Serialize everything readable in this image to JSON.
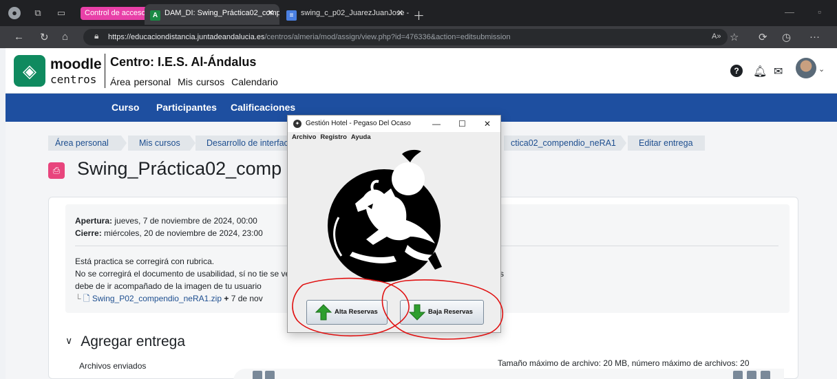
{
  "browser": {
    "tab_group": "Control de accesos",
    "tabs": [
      {
        "title": "DAM_DI: Swing_Práctica02_comp",
        "favicon": "A",
        "active": true
      },
      {
        "title": "swing_c_p02_JuarezJuanJose - Do",
        "favicon": "≡",
        "active": false
      }
    ],
    "url_host": "https://educaciondistancia.juntadeandalucia.es",
    "url_path": "/centros/almeria/mod/assign/view.php?id=476336&action=editsubmission",
    "icons": [
      "back-icon",
      "refresh-icon",
      "home-icon",
      "site-info-icon",
      "read-aloud-icon",
      "favorite-icon",
      "extensions-icon",
      "history-icon",
      "more-icon"
    ]
  },
  "site": {
    "logo_word": "moodle",
    "logo_sub": "centros",
    "centro": "Centro: I.E.S. Al-Ándalus",
    "nav": [
      "Área personal",
      "Mis cursos",
      "Calendario"
    ],
    "help": "?"
  },
  "course_nav": [
    "Curso",
    "Participantes",
    "Calificaciones"
  ],
  "breadcrumb": [
    "Área personal",
    "Mis cursos",
    "Desarrollo de interfac",
    "ctica02_compendio_neRA1",
    "Editar entrega"
  ],
  "page_title": "Swing_Práctica02_comp",
  "assignment": {
    "open_label": "Apertura:",
    "open_value": " jueves, 7 de noviembre de 2024, 00:00",
    "close_label": "Cierre:",
    "close_value": " miércoles, 20 de noviembre de 2024, 23:00",
    "instructions": "Está practica se corregirá con rubrica.\nNo se corregirá el documento de usabilidad, sí no tie                                                        se vea el principio de usabilidad que se esté aplicando, además\ndebe de ir acompañado de la imagen de tu usuario",
    "attachment_name": "Swing_P02_compendio_neRA1.zip",
    "attachment_date": " 7 de nov"
  },
  "submission": {
    "heading": "Agregar entrega",
    "files_label": "Archivos enviados",
    "limits": "Tamaño máximo de archivo: 20 MB, número máximo de archivos: 20"
  },
  "swing_window": {
    "title": "Gestión Hotel - Pegaso Del Ocaso",
    "minimize": "—",
    "maximize": "☐",
    "close": "✕",
    "menu": [
      "Archivo",
      "Registro",
      "Ayuda"
    ],
    "btn_alta": "Alta Reservas",
    "btn_baja": "Baja Reservas",
    "arrow_up_color": "#2e9e2e",
    "arrow_down_color": "#2e9e2e"
  },
  "colors": {
    "moodle_green": "#0f8a5f",
    "course_nav_bg": "#1e4fa0",
    "annotation_red": "#e01010",
    "tab_group": "#e840a8"
  }
}
